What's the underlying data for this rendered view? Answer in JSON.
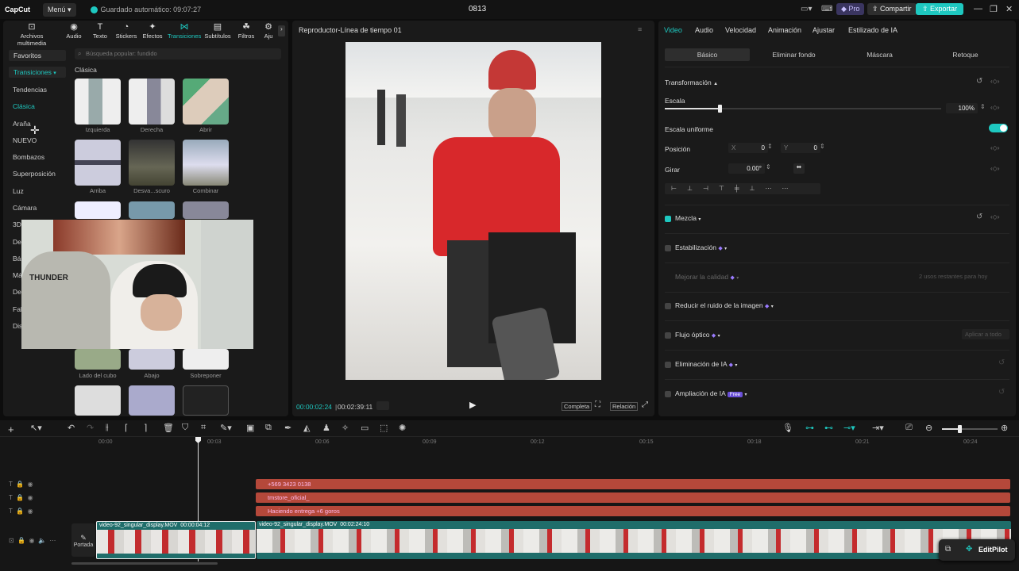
{
  "topbar": {
    "logo": "CapCut",
    "menu": "Menú",
    "autosave": "Guardado automático: 09:07:27",
    "project_title": "0813",
    "pro": "Pro",
    "share": "Compartir",
    "export": "Exportar"
  },
  "tools": [
    {
      "label": "Archivos multimedia",
      "icon": "media-icon"
    },
    {
      "label": "Audio",
      "icon": "audio-icon"
    },
    {
      "label": "Texto",
      "icon": "text-icon"
    },
    {
      "label": "Stickers",
      "icon": "sticker-icon"
    },
    {
      "label": "Efectos",
      "icon": "effects-icon"
    },
    {
      "label": "Transiciones",
      "icon": "transitions-icon"
    },
    {
      "label": "Subtítulos",
      "icon": "subtitles-icon"
    },
    {
      "label": "Filtros",
      "icon": "filters-icon"
    },
    {
      "label": "Aju",
      "icon": "adjust-icon"
    }
  ],
  "categories": {
    "favoritos": "Favoritos",
    "transiciones": "Transiciones",
    "items": [
      "Tendencias",
      "Clásica",
      "Araña",
      "NUEVO",
      "Bombazos",
      "Superposición",
      "Luz",
      "Cámara",
      "3D",
      "De",
      "Bás",
      "Má",
      "De",
      "Fall",
      "Dis"
    ]
  },
  "search_placeholder": "Búsqueda popular: fundido",
  "section_title": "Clásica",
  "thumb_labels": {
    "row1": [
      "Izquierda",
      "Derecha",
      "Abrir"
    ],
    "row2": [
      "Arriba",
      "Desva...scuro",
      "Combinar"
    ],
    "row5": [
      "Lado del cubo",
      "Abajo",
      "Sobreponer"
    ]
  },
  "webcam_text": "THUNDER",
  "player": {
    "title": "Reproductor-Línea de tiempo 01",
    "current_time": "00:00:02:24",
    "total_time": "00:02:39:11",
    "btn_full": "Completa",
    "btn_ratio": "Relación"
  },
  "right": {
    "tabs": [
      "Video",
      "Audio",
      "Velocidad",
      "Animación",
      "Ajustar",
      "Estilizado de IA"
    ],
    "subtabs": [
      "Básico",
      "Eliminar fondo",
      "Máscara",
      "Retoque"
    ],
    "transform": "Transformación",
    "scale": "Escala",
    "scale_value": "100%",
    "scale_level": 0.2,
    "uniform_scale": "Escala uniforme",
    "position": "Posición",
    "pos_x_label": "X",
    "pos_x": "0",
    "pos_y_label": "Y",
    "pos_y": "0",
    "rotate": "Girar",
    "rotate_value": "0.00°",
    "blend": "Mezcla",
    "stabilize": "Estabilización",
    "improve_quality": "Mejorar la calidad",
    "free_attempts": "2 usos restantes para hoy",
    "noise": "Reducir el ruido de la imagen",
    "optical_flow": "Flujo óptico",
    "apply_all": "Aplicar a todo",
    "ai_remove": "Eliminación de IA",
    "ai_expand": "Ampliación de IA",
    "free_badge": "Free"
  },
  "timeline": {
    "ruler": [
      "00:00",
      "00:03",
      "00:06",
      "00:09",
      "00:12",
      "00:15",
      "00:18",
      "00:21",
      "00:24"
    ],
    "text_clips": [
      "+569 3423 0138",
      "tmstore_oficial_",
      "Haciendo entrega +6 goros"
    ],
    "cover": "Portada",
    "clip1_name": "video-92_singular_display.MOV",
    "clip1_dur": "00:00:04:12",
    "clip2_name": "video-92_singular_display.MOV",
    "clip2_dur": "00:02:24:10",
    "editpilot": "EditPilot"
  },
  "colors": {
    "accent": "#1ec8c0",
    "text_clip": "#b5483a",
    "video_clip": "#1f6d6a"
  }
}
